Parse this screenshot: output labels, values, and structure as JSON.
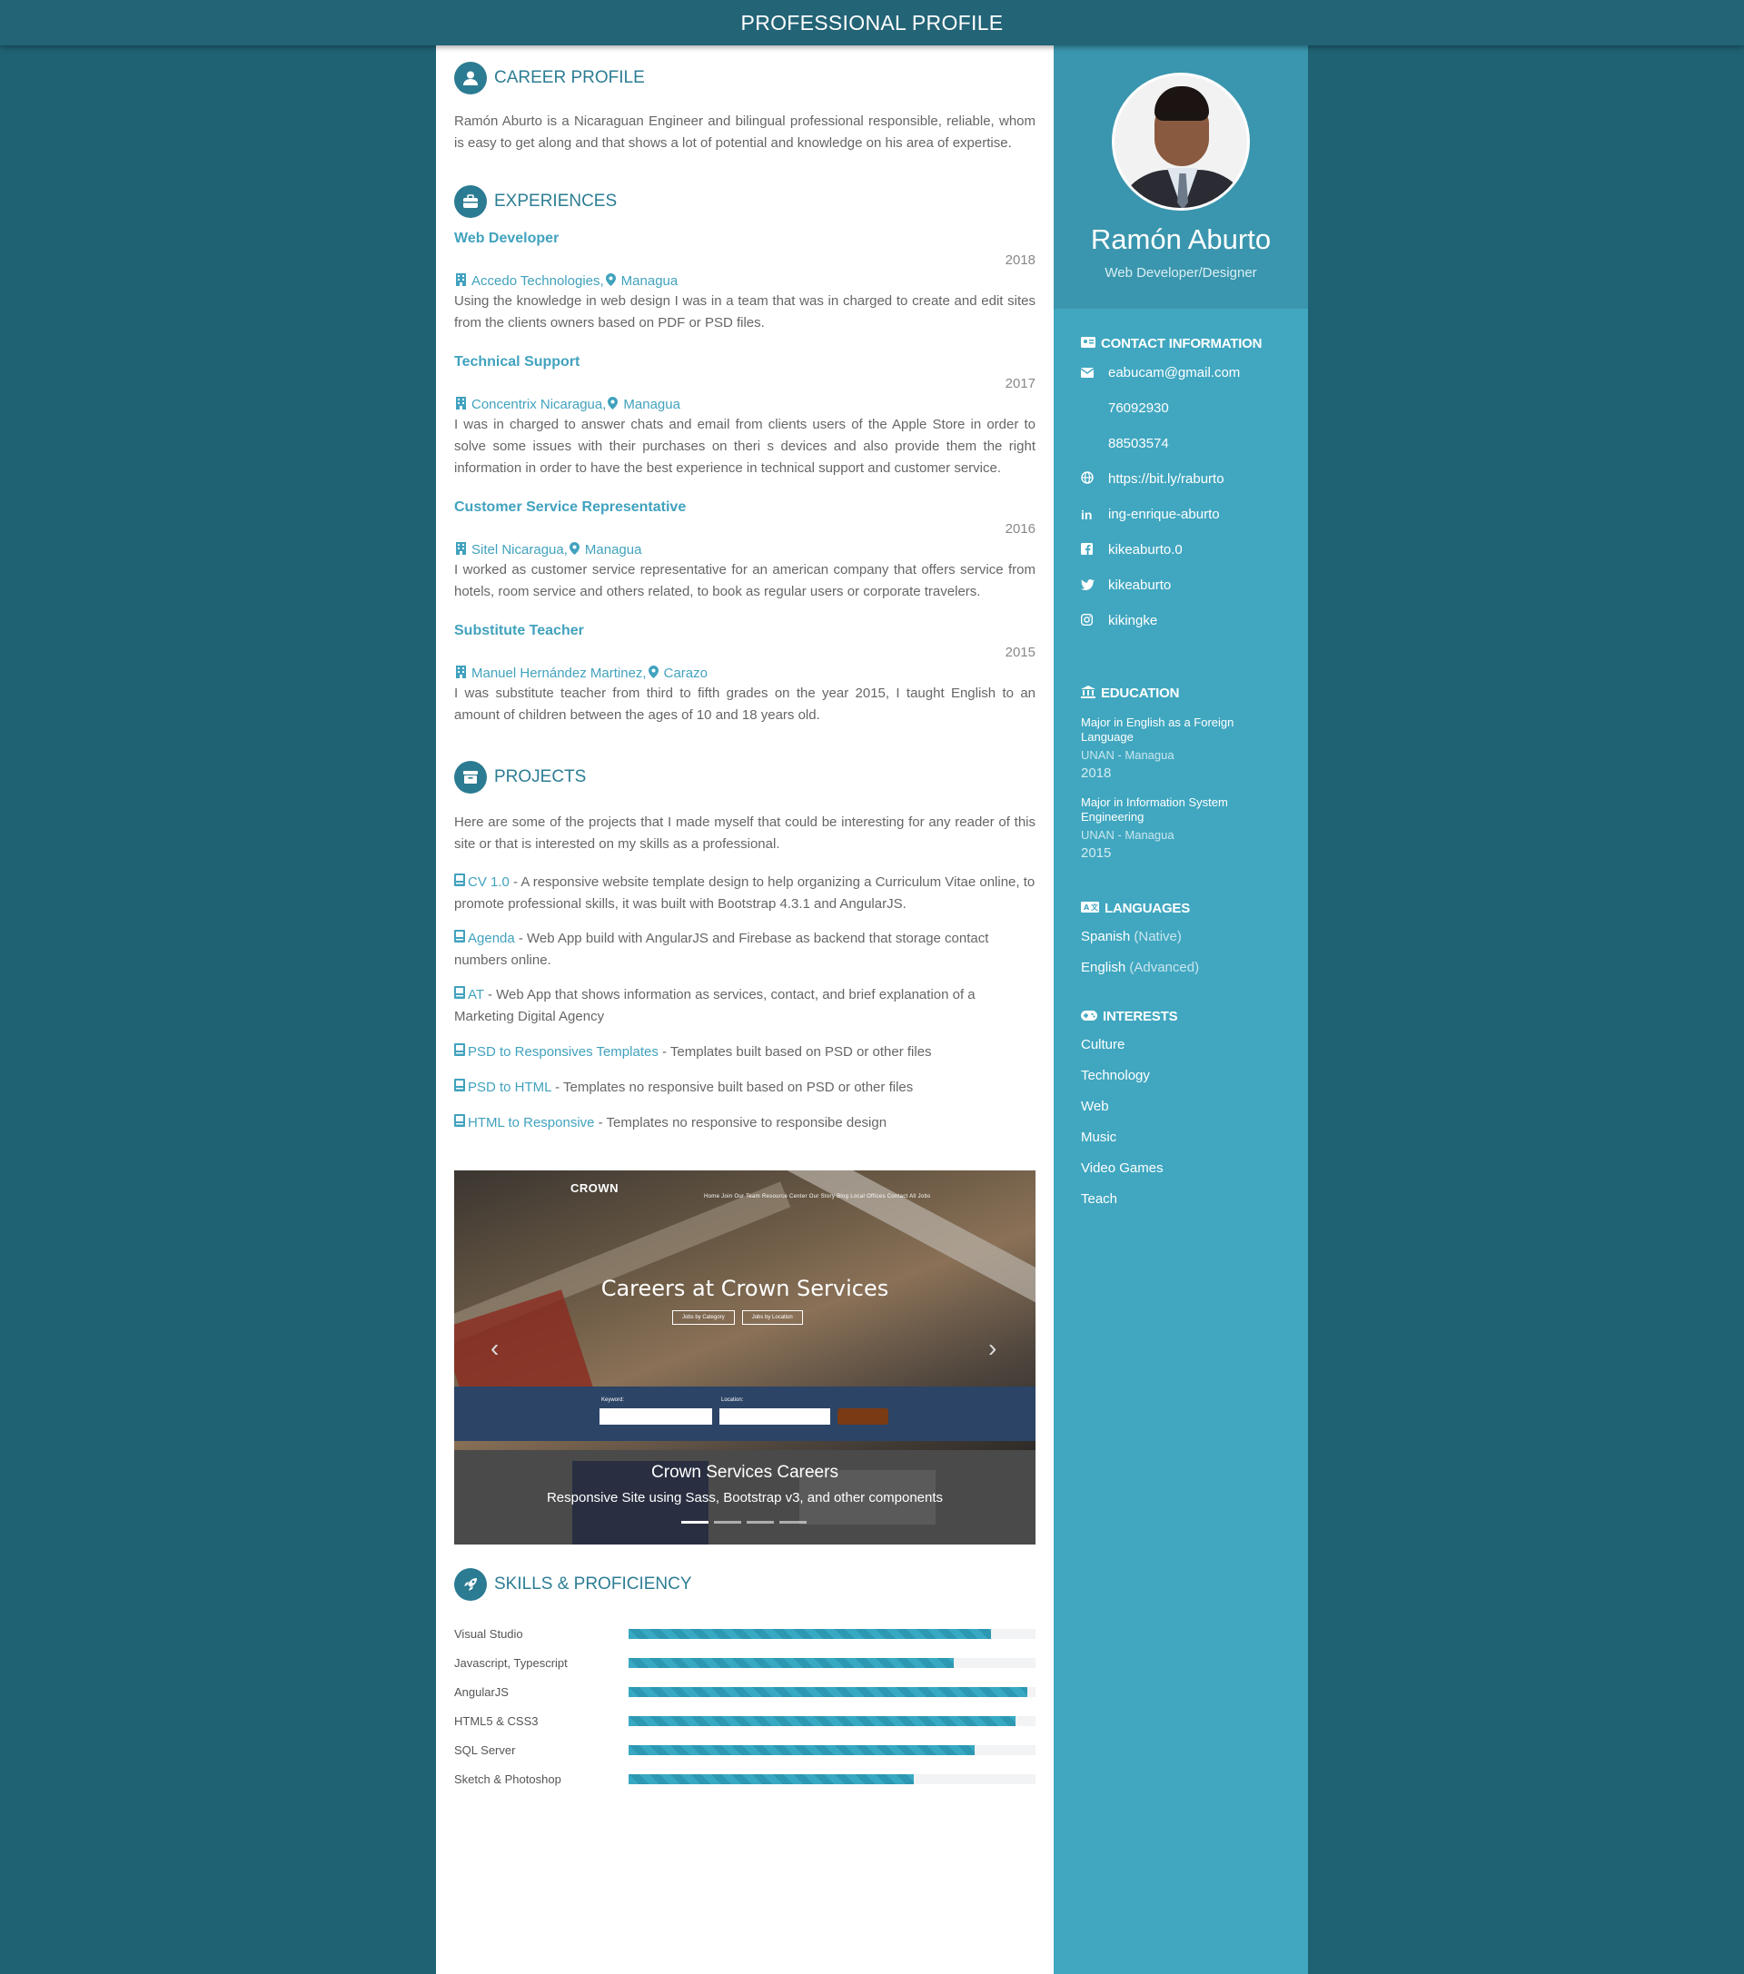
{
  "topbar": {
    "title": "PROFESSIONAL PROFILE"
  },
  "profile": {
    "name": "Ramón Aburto",
    "title": "Web Developer/Designer"
  },
  "career": {
    "heading": "CAREER PROFILE",
    "text": "Ramón Aburto is a Nicaraguan Engineer and bilingual professional responsible, reliable, whom is easy to get along and that shows a lot of potential and knowledge on his area of expertise."
  },
  "experiences": {
    "heading": "EXPERIENCES",
    "items": [
      {
        "title": "Web Developer",
        "year": "2018",
        "company": "Accedo Technologies,",
        "location": "Managua",
        "desc": "Using the knowledge in web design I was in a team that was in charged to create and edit sites from the clients owners based on PDF or PSD files."
      },
      {
        "title": "Technical Support",
        "year": "2017",
        "company": "Concentrix Nicaragua,",
        "location": "Managua",
        "desc": "I was in charged to answer chats and email from clients users of the Apple Store in order to solve some issues with their purchases on theri s devices and also provide them the right information in order to have the best experience in technical support and customer service."
      },
      {
        "title": "Customer Service Representative",
        "year": "2016",
        "company": "Sitel Nicaragua,",
        "location": "Managua",
        "desc": "I worked as customer service representative for an american company that offers service from hotels, room service and others related, to book as regular users or corporate travelers."
      },
      {
        "title": "Substitute Teacher",
        "year": "2015",
        "company": "Manuel Hernández Martinez,",
        "location": "Carazo",
        "desc": "I was substitute teacher from third to fifth grades on the year 2015, I taught English to an amount of children between the ages of 10 and 18 years old."
      }
    ]
  },
  "projects": {
    "heading": "PROJECTS",
    "intro": "Here are some of the projects that I made myself that could be interesting for any reader of this site or that is interested on my skills as a professional.",
    "items": [
      {
        "name": "CV 1.0",
        "desc": " - A responsive website template design to help organizing a Curriculum Vitae online, to promote professional skills, it was built with Bootstrap 4.3.1 and AngularJS."
      },
      {
        "name": "Agenda",
        "desc": " - Web App build with AngularJS and Firebase as backend that storage contact numbers online."
      },
      {
        "name": "AT",
        "desc": " - Web App that shows information as services, contact, and brief explanation of a Marketing Digital Agency"
      },
      {
        "name": "PSD to Responsives Templates",
        "desc": " - Templates built based on PSD or other files"
      },
      {
        "name": "PSD to HTML",
        "desc": " - Templates no responsive built based on PSD or other files"
      },
      {
        "name": "HTML to Responsive",
        "desc": " - Templates no responsive to responsibe design"
      }
    ],
    "carousel": {
      "caption_title": "Crown Services Careers",
      "caption_sub": "Responsive Site using Sass, Bootstrap v3, and other components",
      "screenshot_headline": "Careers at Crown Services",
      "screenshot_logo": "CROWN",
      "screenshot_nav": "Home   Join Our Team   Resource Center   Our Story   Blog   Local Offices   Contact   All Jobs",
      "btn_category": "Jobs by Category",
      "btn_location": "Jobs by Location",
      "label_keyword": "Keyword:",
      "label_location": "Location:",
      "slide_count": 4,
      "active_slide": 1
    }
  },
  "skills": {
    "heading": "SKILLS & PROFICIENCY",
    "items": [
      {
        "name": "Visual Studio",
        "level": 89
      },
      {
        "name": "Javascript, Typescript",
        "level": 80
      },
      {
        "name": "AngularJS",
        "level": 98
      },
      {
        "name": "HTML5 & CSS3",
        "level": 95
      },
      {
        "name": "SQL Server",
        "level": 85
      },
      {
        "name": "Sketch & Photoshop",
        "level": 70
      }
    ]
  },
  "contact": {
    "heading": "CONTACT INFORMATION",
    "email": "eabucam@gmail.com",
    "phone1": "76092930",
    "phone2": "88503574",
    "website": "https://bit.ly/raburto",
    "linkedin": "ing-enrique-aburto",
    "facebook": "kikeaburto.0",
    "twitter": "kikeaburto",
    "instagram": "kikingke"
  },
  "education": {
    "heading": "EDUCATION",
    "items": [
      {
        "degree": "Major in English as a Foreign Language",
        "school": "UNAN - Managua",
        "year": "2018"
      },
      {
        "degree": "Major in Information System Engineering",
        "school": "UNAN - Managua",
        "year": "2015"
      }
    ]
  },
  "languages": {
    "heading": "LANGUAGES",
    "items": [
      {
        "name": "Spanish",
        "level": "(Native)"
      },
      {
        "name": "English",
        "level": "(Advanced)"
      }
    ]
  },
  "interests": {
    "heading": "INTERESTS",
    "items": [
      "Culture",
      "Technology",
      "Web",
      "Music",
      "Video Games",
      "Teach"
    ]
  },
  "colors": {
    "page_bg": "#1f6273",
    "accent": "#41a7c0",
    "heading": "#2d7d94",
    "link": "#41a2be"
  }
}
